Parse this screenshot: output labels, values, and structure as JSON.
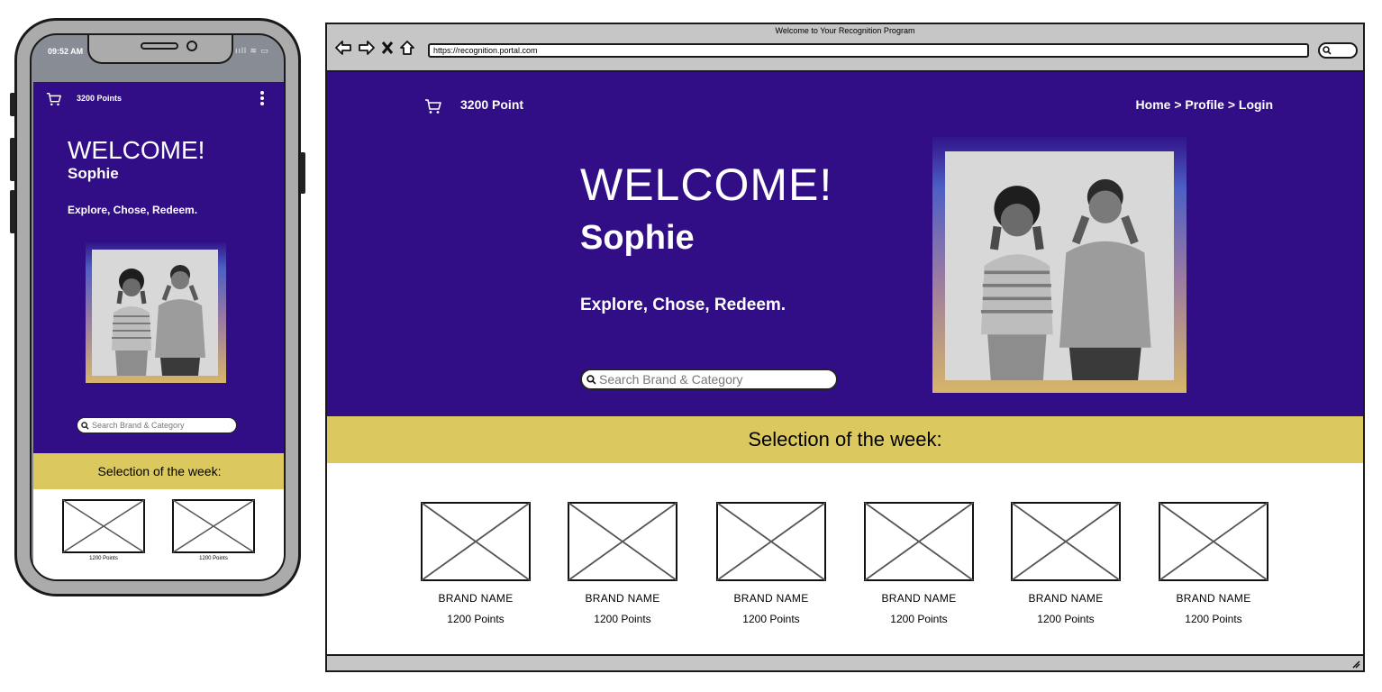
{
  "phone": {
    "time": "09:52 AM",
    "status": "ııll ≋ ▭",
    "points": "3200 Points",
    "welcome": "WELCOME!",
    "name": "Sophie",
    "tagline": "Explore, Chose, Redeem.",
    "search_placeholder": "Search Brand & Category",
    "section_title": "Selection of the week:",
    "cards": [
      {
        "points": "1200 Points"
      },
      {
        "points": "1200 Points"
      }
    ]
  },
  "browser": {
    "window_title": "Welcome to Your Recognition Program",
    "url": "https://recognition.portal.com",
    "points": "3200 Point",
    "breadcrumb": "Home > Profile > Login",
    "welcome": "WELCOME!",
    "name": "Sophie",
    "tagline": "Explore, Chose, Redeem.",
    "search_placeholder": "Search Brand & Category",
    "section_title": "Selection of the week:",
    "cards": [
      {
        "brand": "BRAND NAME",
        "points": "1200 Points"
      },
      {
        "brand": "BRAND NAME",
        "points": "1200 Points"
      },
      {
        "brand": "BRAND NAME",
        "points": "1200 Points"
      },
      {
        "brand": "BRAND NAME",
        "points": "1200 Points"
      },
      {
        "brand": "BRAND NAME",
        "points": "1200 Points"
      },
      {
        "brand": "BRAND NAME",
        "points": "1200 Points"
      }
    ]
  },
  "colors": {
    "hero_bg": "#310e85",
    "section_bg": "#dbc95f",
    "chrome_bg": "#c6c6c6"
  },
  "icons": {
    "cart": "cart-icon",
    "menu": "kebab-menu-icon",
    "search": "search-icon",
    "back": "back-arrow-icon",
    "forward": "forward-arrow-icon",
    "close": "close-icon",
    "home": "home-icon",
    "resize": "resize-grip-icon"
  }
}
